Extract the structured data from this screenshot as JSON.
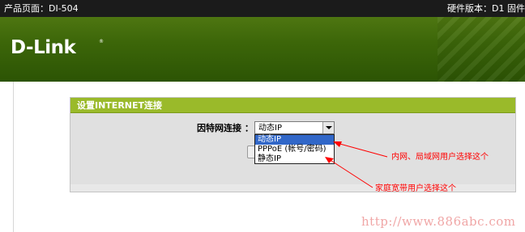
{
  "topbar": {
    "product": "产品页面：DI-504",
    "hardware": "硬件版本：D1 固件"
  },
  "brand": {
    "logo": "D-Link",
    "trademark": "®"
  },
  "panel": {
    "title": "设置INTERNET连接",
    "field_label": "因特网连接 ：",
    "selected_value": "动态IP",
    "options": [
      "动态IP",
      "PPPoE (帐号/密码)",
      "静态IP"
    ]
  },
  "annotations": {
    "lan_user": "内网、局域网用户选择这个",
    "home_broadband": "家庭宽带用户选择这个"
  },
  "watermark": "http://www.886abc.com",
  "colors": {
    "topbar": "#1b1b1b",
    "banner": "#3c6609",
    "panel_header": "#9aba2a",
    "selected_option": "#3167c8",
    "annotation": "#ff0000",
    "watermark": "#f0a6a6"
  },
  "icons": {
    "dropdown_arrow": "chevron-down-icon",
    "annotation_arrows": "red-arrow"
  }
}
